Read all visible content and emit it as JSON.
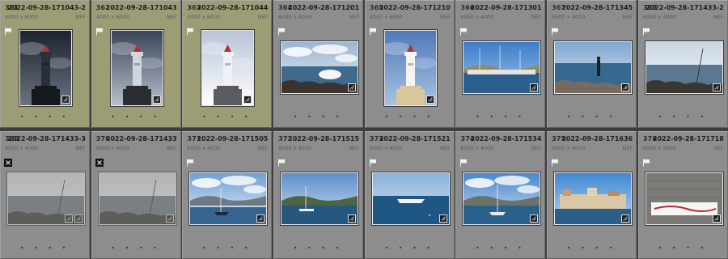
{
  "colors": {
    "cell_bg": "#8d8d8d",
    "selected_bg": "#9d9d75",
    "grid_bg": "#3e3e3e"
  },
  "cells": [
    {
      "index": "361",
      "filename": "2022-09-28-171043-2",
      "dims": "4000 x 6000",
      "ext": "NEF",
      "flag": "white-flag",
      "selected": true,
      "orientation": "portrait",
      "scene": "lighthouse-dark",
      "rejected_dim": false,
      "badges": 1,
      "dots": "• • • •"
    },
    {
      "index": "362",
      "filename": "2022-09-28-171043",
      "dims": "4000 x 6000",
      "ext": "NEF",
      "flag": "white-flag",
      "selected": true,
      "orientation": "portrait",
      "scene": "lighthouse-mid",
      "rejected_dim": false,
      "badges": 1,
      "dots": "• • • •"
    },
    {
      "index": "363",
      "filename": "2022-09-28-171044",
      "dims": "4000 x 6000",
      "ext": "NEF",
      "flag": "white-flag",
      "selected": true,
      "orientation": "portrait",
      "scene": "lighthouse-bright",
      "rejected_dim": false,
      "badges": 1,
      "dots": "• • • •"
    },
    {
      "index": "364",
      "filename": "2022-09-28-171201",
      "dims": "6000 x 4000",
      "ext": "NEF",
      "flag": "white-flag",
      "selected": false,
      "orientation": "landscape",
      "scene": "rocks-wave",
      "rejected_dim": false,
      "badges": 1,
      "dots": "• • • •"
    },
    {
      "index": "365",
      "filename": "2022-09-28-171210",
      "dims": "4000 x 6000",
      "ext": "NEF",
      "flag": "white-flag",
      "selected": false,
      "orientation": "portrait",
      "scene": "lighthouse-blue",
      "rejected_dim": false,
      "badges": 1,
      "dots": "• • • •"
    },
    {
      "index": "366",
      "filename": "2022-09-28-171301",
      "dims": "6000 x 4000",
      "ext": "NEF",
      "flag": "white-flag",
      "selected": false,
      "orientation": "landscape",
      "scene": "harbor-boats",
      "rejected_dim": false,
      "badges": 1,
      "dots": "• • • •"
    },
    {
      "index": "367",
      "filename": "2022-09-28-171345",
      "dims": "6000 x 4000",
      "ext": "NEF",
      "flag": "white-flag",
      "selected": false,
      "orientation": "landscape",
      "scene": "person-shore",
      "rejected_dim": false,
      "badges": 1,
      "dots": "• • • •"
    },
    {
      "index": "368",
      "filename": "2022-09-28-171433-2",
      "dims": "6000 x 4000",
      "ext": "NEF",
      "flag": "white-flag",
      "selected": false,
      "orientation": "landscape",
      "scene": "mast-bright",
      "rejected_dim": false,
      "badges": 1,
      "dots": "• • • •"
    },
    {
      "index": "369",
      "filename": "2022-09-28-171433-3",
      "dims": "6000 x 4000",
      "ext": "NEF",
      "flag": "reject-flag",
      "selected": false,
      "orientation": "landscape",
      "scene": "mast-bright",
      "rejected_dim": true,
      "badges": 2,
      "dots": "• • • •"
    },
    {
      "index": "370",
      "filename": "2022-09-28-171433",
      "dims": "6000 x 4000",
      "ext": "NEF",
      "flag": "reject-flag",
      "selected": false,
      "orientation": "landscape",
      "scene": "mast-bright",
      "rejected_dim": true,
      "badges": 1,
      "dots": "• • • •"
    },
    {
      "index": "371",
      "filename": "2022-09-28-171505",
      "dims": "6000 x 4000",
      "ext": "NEF",
      "flag": "white-flag",
      "selected": false,
      "orientation": "landscape",
      "scene": "sailboat-clouds",
      "rejected_dim": false,
      "badges": 1,
      "dots": "• • • •"
    },
    {
      "index": "372",
      "filename": "2022-09-28-171515",
      "dims": "6000 x 4000",
      "ext": "NEF",
      "flag": "white-flag",
      "selected": false,
      "orientation": "landscape",
      "scene": "bay-hills",
      "rejected_dim": false,
      "badges": 1,
      "dots": "• • • •"
    },
    {
      "index": "373",
      "filename": "2022-09-28-171521",
      "dims": "6000 x 4000",
      "ext": "NEF",
      "flag": "white-flag",
      "selected": false,
      "orientation": "landscape",
      "scene": "yacht-blue",
      "rejected_dim": false,
      "badges": 1,
      "dots": "• • • •"
    },
    {
      "index": "374",
      "filename": "2022-09-28-171534",
      "dims": "6000 x 4000",
      "ext": "NEF",
      "flag": "white-flag",
      "selected": false,
      "orientation": "landscape",
      "scene": "sailboat-clouds2",
      "rejected_dim": false,
      "badges": 1,
      "dots": "• • • •"
    },
    {
      "index": "375",
      "filename": "2022-09-28-171636",
      "dims": "6000 x 4000",
      "ext": "NEF",
      "flag": "white-flag",
      "selected": false,
      "orientation": "landscape",
      "scene": "town-harbor",
      "rejected_dim": false,
      "badges": 1,
      "dots": "• • • •"
    },
    {
      "index": "376",
      "filename": "2022-09-28-171718",
      "dims": "6000 x 4000",
      "ext": "NEF",
      "flag": "white-flag",
      "selected": false,
      "orientation": "landscape",
      "scene": "wall-banner",
      "rejected_dim": false,
      "badges": 1,
      "dots": "• • • •"
    }
  ]
}
